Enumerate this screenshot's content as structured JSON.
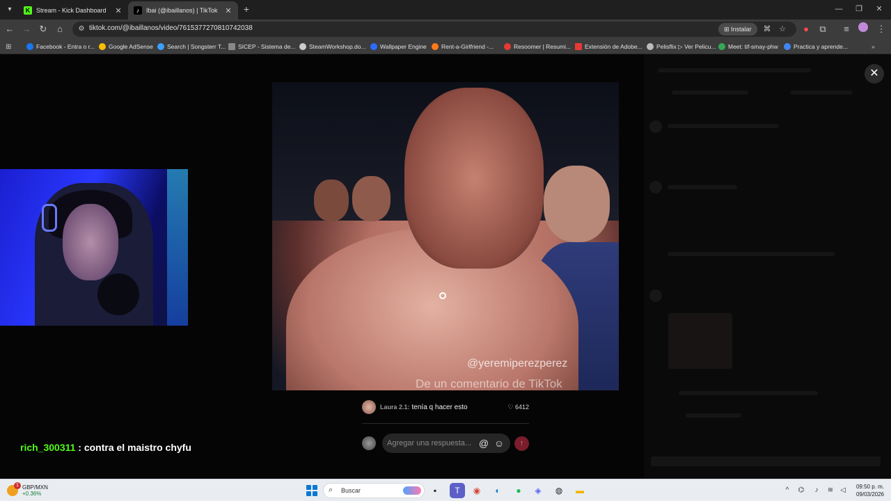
{
  "browser": {
    "tabs": [
      {
        "title": "Stream - Kick Dashboard",
        "favicon": "kick-logo-icon",
        "active": false
      },
      {
        "title": "Ibai (@ibaillanos) | TikTok",
        "favicon": "tiktok-logo-icon",
        "active": true
      }
    ],
    "url": "tiktok.com/@ibaillanos/video/7615377270810742038",
    "install_label": "Instalar",
    "bookmarks": [
      {
        "label": "Facebook - Entra o r...",
        "color": "#1877f2"
      },
      {
        "label": "Google AdSense",
        "color": "#fbbc04"
      },
      {
        "label": "Search | Songsterr T...",
        "color": "#3aa0ff"
      },
      {
        "label": "SICEP - Sistema de...",
        "color": "#888888"
      },
      {
        "label": "SteamWorkshop.do...",
        "color": "#cccccc"
      },
      {
        "label": "Wallpaper Engine",
        "color": "#2a6cff"
      },
      {
        "label": "Rent-a-Girlfriend -...",
        "color": "#ff7a1a"
      },
      {
        "label": "Resoomer | Resumi...",
        "color": "#e53935"
      },
      {
        "label": "Extensión de Adobe...",
        "color": "#e53935"
      },
      {
        "label": "Pelisflix ▷ Ver Pelicu...",
        "color": "#bbbbbb"
      },
      {
        "label": "Meet: tif-smay-phw",
        "color": "#34a853"
      },
      {
        "label": "Practica y aprende...",
        "color": "#4285f4"
      }
    ]
  },
  "video": {
    "watermark": "@yeremiperezperez",
    "caption": "De un comentario de TikTok"
  },
  "comment": {
    "author": "Laura 2.1:",
    "text": "tenía q hacer esto",
    "likes": "6412"
  },
  "reply": {
    "placeholder": "Agregar una respuesta..."
  },
  "stream_chat": {
    "user": "rich_300311",
    "message": " : contra el maistro chyfu"
  },
  "taskbar": {
    "widget_title": "GBP/MXN",
    "widget_delta": "+0.36%",
    "widget_badge": "1",
    "search_placeholder": "Buscar",
    "time": "09:50 p. m.",
    "date": "09/03/2026"
  },
  "colors": {
    "kick_green": "#53fc18",
    "send_button": "#7a1d2c"
  }
}
